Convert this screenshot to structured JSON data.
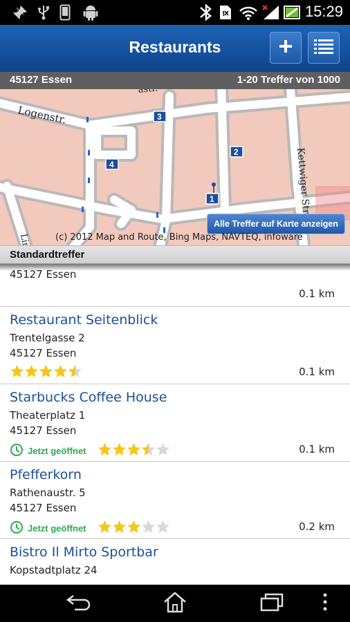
{
  "status_bar": {
    "time": "15:29",
    "left_icons": [
      "pin-icon",
      "usb-icon",
      "phone-icon",
      "android-icon"
    ],
    "right_icons": [
      "bluetooth-icon",
      "sim-icon",
      "wifi-icon",
      "signal-icon",
      "battery-icon"
    ]
  },
  "action_bar": {
    "title": "Restaurants",
    "add_icon": "plus-icon",
    "list_icon": "list-icon",
    "accent": "#14509b"
  },
  "location_bar": {
    "location": "45127 Essen",
    "results": "1-20 Treffer von 1000"
  },
  "map": {
    "streets": [
      "Logenstr.",
      "Kettwiger Str.",
      "Lin",
      "...astr."
    ],
    "markers": [
      "1",
      "2",
      "3",
      "4"
    ],
    "show_all_button": "Alle Treffer auf Karte anzeigen",
    "copyright": "(c) 2012 Map and Route, Bing Maps, NAVTEQ, infoware"
  },
  "section_header": "Standardtreffer",
  "results": [
    {
      "name": "",
      "street": "",
      "city": "45127 Essen",
      "open_label": "",
      "rating": null,
      "distance": "0.1 km"
    },
    {
      "name": "Restaurant Seitenblick",
      "street": "Trentelgasse 2",
      "city": "45127 Essen",
      "open_label": "",
      "rating": 4.5,
      "distance": "0.1 km"
    },
    {
      "name": "Starbucks Coffee House",
      "street": "Theaterplatz 1",
      "city": "45127 Essen",
      "open_label": "Jetzt geöffnet",
      "rating": 3.5,
      "distance": "0.1 km"
    },
    {
      "name": "Pfefferkorn",
      "street": "Rathenaustr. 5",
      "city": "45127 Essen",
      "open_label": "Jetzt geöffnet",
      "rating": 3,
      "distance": "0.2 km"
    },
    {
      "name": "Bistro Il Mirto Sportbar",
      "street": "Kopstadtplatz 24",
      "city": "",
      "open_label": "",
      "rating": null,
      "distance": ""
    }
  ],
  "colors": {
    "star_filled": "#f5c518",
    "star_empty": "#d8d8d8",
    "open_green": "#2fa84f",
    "link_blue": "#1a4f9c"
  },
  "nav_bar": {
    "icons": [
      "back-icon",
      "home-icon",
      "recent-apps-icon",
      "menu-icon"
    ]
  }
}
